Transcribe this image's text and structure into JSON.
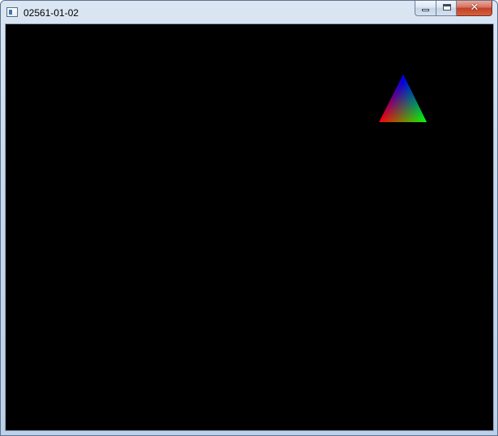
{
  "window": {
    "title": "02561-01-02",
    "icon": "application-icon",
    "buttons": {
      "minimize": "minimize-icon",
      "maximize": "maximize-icon",
      "close_glyph": "✕"
    }
  },
  "canvas": {
    "background": "#000000",
    "triangle": {
      "vertex_colors": [
        "#0000ff",
        "#ff0000",
        "#00ff00"
      ]
    }
  }
}
